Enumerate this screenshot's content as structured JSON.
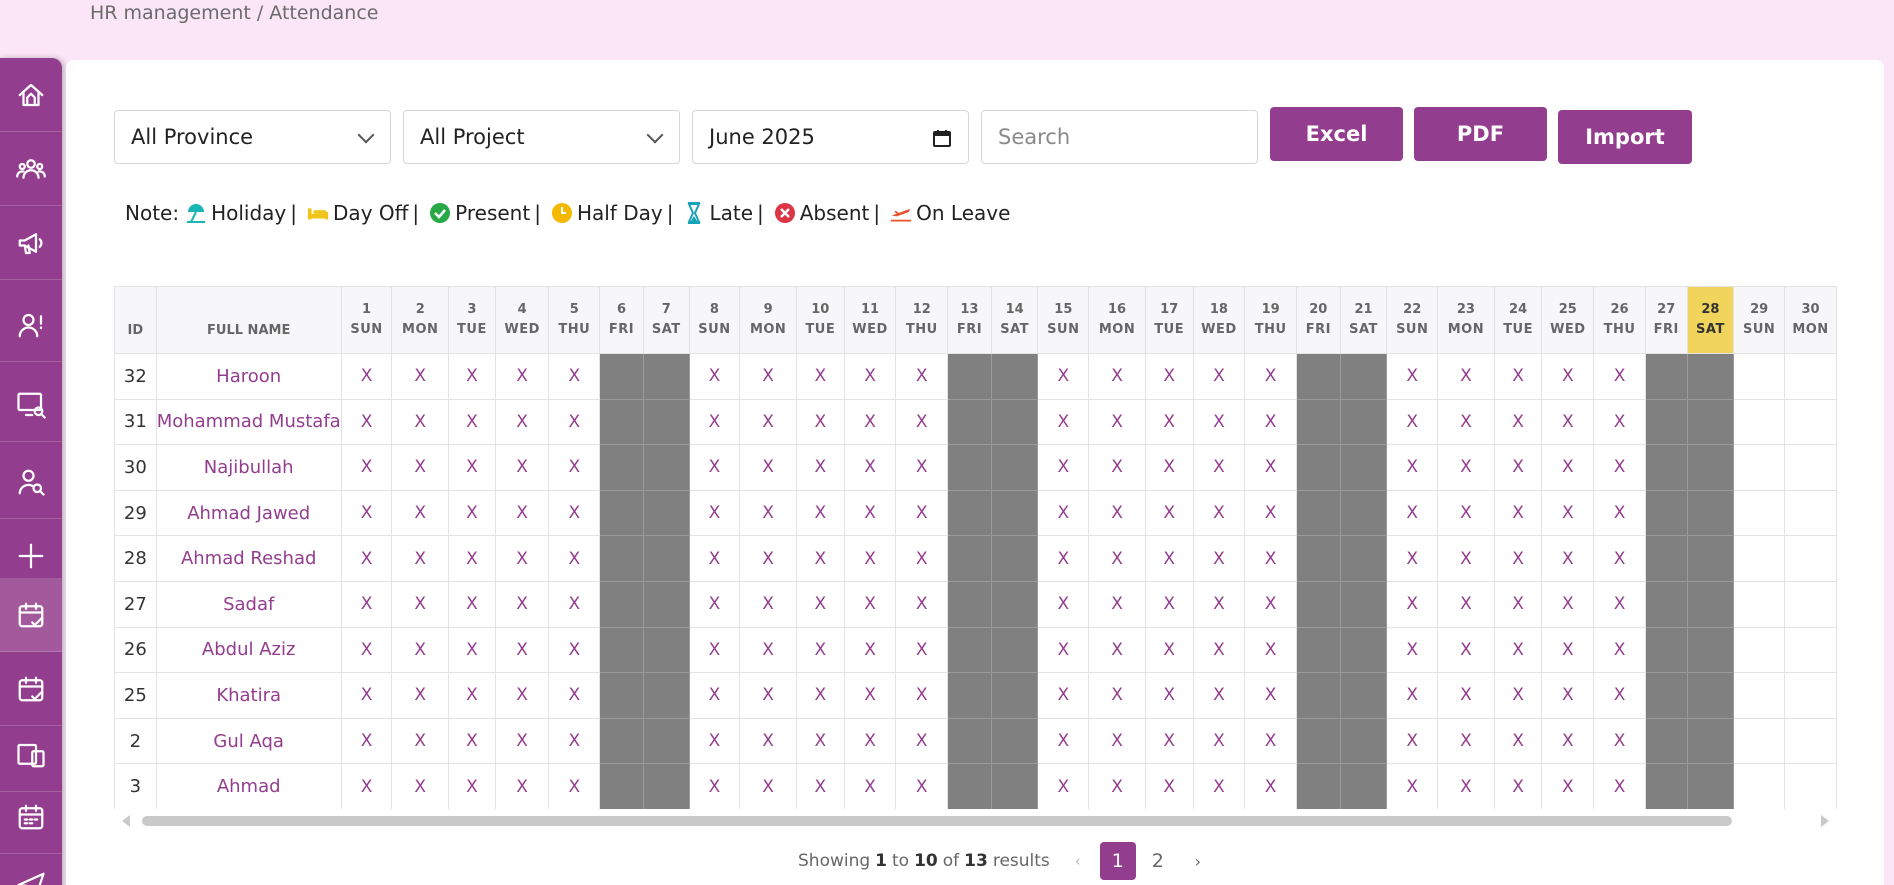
{
  "breadcrumb": "HR management / Attendance",
  "sidebar": {
    "items": [
      {
        "icon": "dashboard-icon"
      },
      {
        "icon": "users-icon"
      },
      {
        "icon": "megaphone-icon"
      },
      {
        "icon": "user-alert-icon"
      },
      {
        "icon": "monitor-search-icon"
      },
      {
        "icon": "user-search-icon"
      },
      {
        "icon": "plus-icon"
      },
      {
        "icon": "calendar-check-icon",
        "active": true
      },
      {
        "icon": "calendar-check-icon"
      },
      {
        "icon": "devices-icon"
      },
      {
        "icon": "calendar-icon"
      },
      {
        "icon": "send-icon"
      }
    ]
  },
  "filters": {
    "province": "All Province",
    "project": "All Project",
    "month": "June 2025",
    "search_placeholder": "Search"
  },
  "buttons": {
    "excel": "Excel",
    "pdf": "PDF",
    "import": "Import"
  },
  "legend": {
    "prefix": "Note:",
    "items": [
      {
        "label": "Holiday",
        "icon": "umbrella-beach-icon",
        "color": "#1ab5b5"
      },
      {
        "label": "Day Off",
        "icon": "bed-icon",
        "color": "#f0c419"
      },
      {
        "label": "Present",
        "icon": "check-circle-icon",
        "color": "#28a745"
      },
      {
        "label": "Half Day",
        "icon": "clock-icon",
        "color": "#f5b800"
      },
      {
        "label": "Late",
        "icon": "hourglass-icon",
        "color": "#17a2b8"
      },
      {
        "label": "Absent",
        "icon": "x-circle-icon",
        "color": "#dc3545"
      },
      {
        "label": "On Leave",
        "icon": "plane-icon",
        "color": "#e8502e"
      }
    ]
  },
  "table": {
    "headers": {
      "id": "ID",
      "name": "FULL NAME"
    },
    "highlight_day": 28,
    "days": [
      {
        "n": "1",
        "d": "SUN"
      },
      {
        "n": "2",
        "d": "MON"
      },
      {
        "n": "3",
        "d": "TUE"
      },
      {
        "n": "4",
        "d": "WED"
      },
      {
        "n": "5",
        "d": "THU"
      },
      {
        "n": "6",
        "d": "FRI"
      },
      {
        "n": "7",
        "d": "SAT"
      },
      {
        "n": "8",
        "d": "SUN"
      },
      {
        "n": "9",
        "d": "MON"
      },
      {
        "n": "10",
        "d": "TUE"
      },
      {
        "n": "11",
        "d": "WED"
      },
      {
        "n": "12",
        "d": "THU"
      },
      {
        "n": "13",
        "d": "FRI"
      },
      {
        "n": "14",
        "d": "SAT"
      },
      {
        "n": "15",
        "d": "SUN"
      },
      {
        "n": "16",
        "d": "MON"
      },
      {
        "n": "17",
        "d": "TUE"
      },
      {
        "n": "18",
        "d": "WED"
      },
      {
        "n": "19",
        "d": "THU"
      },
      {
        "n": "20",
        "d": "FRI"
      },
      {
        "n": "21",
        "d": "SAT"
      },
      {
        "n": "22",
        "d": "SUN"
      },
      {
        "n": "23",
        "d": "MON"
      },
      {
        "n": "24",
        "d": "TUE"
      },
      {
        "n": "25",
        "d": "WED"
      },
      {
        "n": "26",
        "d": "THU"
      },
      {
        "n": "27",
        "d": "FRI"
      },
      {
        "n": "28",
        "d": "SAT"
      },
      {
        "n": "29",
        "d": "SUN"
      },
      {
        "n": "30",
        "d": "MON"
      }
    ],
    "mark": "X",
    "rows": [
      {
        "id": "32",
        "name": "Haroon"
      },
      {
        "id": "31",
        "name": "Mohammad Mustafa"
      },
      {
        "id": "30",
        "name": "Najibullah"
      },
      {
        "id": "29",
        "name": "Ahmad Jawed"
      },
      {
        "id": "28",
        "name": "Ahmad Reshad"
      },
      {
        "id": "27",
        "name": "Sadaf"
      },
      {
        "id": "26",
        "name": "Abdul Aziz"
      },
      {
        "id": "25",
        "name": "Khatira"
      },
      {
        "id": "2",
        "name": "Gul Aqa"
      },
      {
        "id": "3",
        "name": "Ahmad"
      }
    ]
  },
  "pagination": {
    "showing": "Showing",
    "from": "1",
    "to_word": "to",
    "to": "10",
    "of_word": "of",
    "total": "13",
    "results": "results",
    "prev": "‹",
    "pages": [
      "1",
      "2"
    ],
    "current": "1",
    "next": "›"
  }
}
